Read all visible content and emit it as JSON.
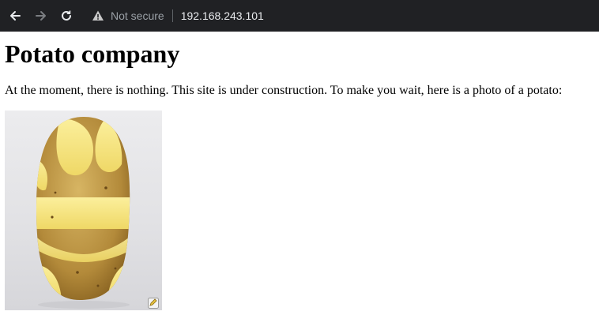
{
  "browser": {
    "back_icon": "arrow-left-icon",
    "forward_icon": "arrow-right-icon",
    "reload_icon": "reload-icon",
    "security_icon": "warning-triangle-icon",
    "security_label": "Not secure",
    "url": "192.168.243.101",
    "colors": {
      "toolbar": "#202124",
      "url": "#e8eaed",
      "muted": "#9aa0a6"
    }
  },
  "page": {
    "title": "Potato company",
    "intro": "At the moment, there is nothing. This site is under construction. To make you wait, here is a photo of a potato:"
  }
}
